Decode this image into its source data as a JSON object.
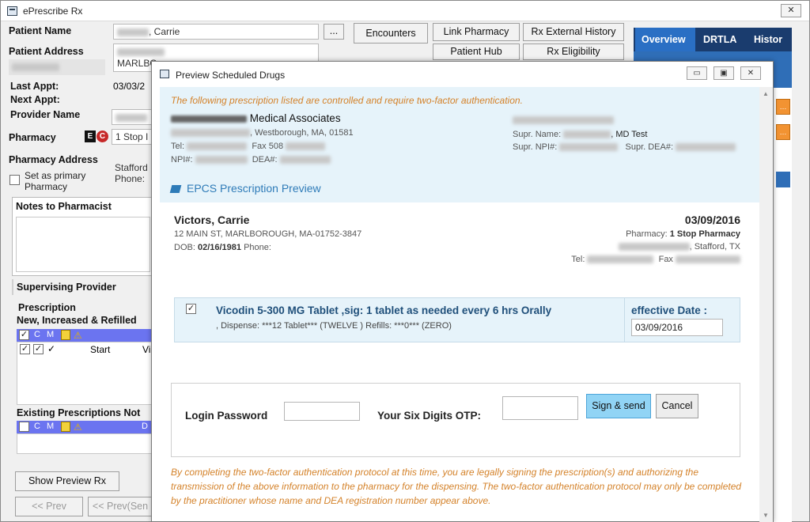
{
  "main": {
    "title": "ePrescribe Rx",
    "close_glyph": "✕",
    "labels": {
      "patient_name": "Patient Name",
      "patient_address": "Patient Address",
      "last_appt": "Last Appt:",
      "next_appt": "Next Appt:",
      "provider_name": "Provider Name",
      "pharmacy": "Pharmacy",
      "pharmacy_address": "Pharmacy Address",
      "set_primary": "Set as primary",
      "set_primary_2": "Pharmacy",
      "notes": "Notes to Pharmacist",
      "supervising": "Supervising Provider",
      "prescription": "Prescription",
      "new_increased": "New, Increased & Refilled",
      "existing": "Existing Prescriptions Not",
      "start_col": "Start",
      "vi_col": "Vi",
      "d_col": "D"
    },
    "values": {
      "patient_name_tail": ", Carrie",
      "address_line2": "MARLBO",
      "last_appt_value": "03/03/2",
      "pharmacy_value": "1 Stop I",
      "pharmacy_addr_1": "Stafford",
      "pharmacy_addr_2": "Phone:",
      "ellipsis": "..."
    },
    "buttons": {
      "encounters": "Encounters",
      "link_pharmacy": "Link Pharmacy",
      "rx_history": "Rx External History",
      "patient_hub": "Patient Hub",
      "rx_eligibility": "Rx Eligibility",
      "show_preview": "Show Preview Rx",
      "prev": "<< Prev",
      "prev_sen": "<< Prev(Sen"
    },
    "tabs": [
      "Overview",
      "DRTLA",
      "Histor"
    ],
    "grid_headers": [
      "C",
      "M"
    ]
  },
  "modal": {
    "title": "Preview Scheduled Drugs",
    "warning": "The following prescription listed are controlled and require two-factor authentication.",
    "practice_name": "Medical Associates",
    "practice_city": ", Westborough, MA, 01581",
    "tel_label": "Tel:",
    "fax_label": "Fax",
    "fax_prefix": "508",
    "npi_label": "NPI#:",
    "dea_label": "DEA#:",
    "supr_name_label": "Supr. Name:",
    "supr_name_tail": ", MD Test",
    "supr_npi_label": "Supr. NPI#:",
    "supr_dea_label": "Supr. DEA#:",
    "epcs_title": "EPCS Prescription Preview",
    "patient": {
      "name": "Victors, Carrie",
      "address": "12 MAIN ST, MARLBOROUGH, MA-01752-3847",
      "dob_label": "DOB:",
      "dob": "02/16/1981",
      "phone_label": "Phone:",
      "date": "03/09/2016",
      "pharmacy_label": "Pharmacy:",
      "pharmacy_name": "1 Stop Pharmacy",
      "pharmacy_city": ", Stafford, TX",
      "tel_label": "Tel:",
      "fax_label": "Fax"
    },
    "drug": {
      "checked": "✓",
      "name": "Vicodin 5-300 MG Tablet ,sig: 1 tablet as needed every 6 hrs Orally",
      "details": ", Dispense: ***12 Tablet*** (TWELVE ) Refills: ***0*** (ZERO)",
      "effective_label": "effective Date :",
      "effective_value": "03/09/2016"
    },
    "auth": {
      "login_label": "Login Password",
      "otp_label": "Your Six Digits OTP:",
      "sign_button": "Sign & send",
      "cancel_button": "Cancel"
    },
    "footer": "By completing the two-factor authentication protocol at this time, you are legally signing the prescription(s) and authorizing the transmission of the above information to the pharmacy for the dispensing. The two-factor authentication protocol may only be completed by the practitioner whose name and DEA registration number appear above.",
    "window_buttons": {
      "minimize": "▭",
      "restore": "▣",
      "close": "✕"
    }
  },
  "colors": {
    "warning": "#d4822a",
    "header_bg": "#e6f3fa",
    "drug_text": "#1f4f7a",
    "sign_button": "#91d4f5",
    "tab_bar": "#1a3c6e",
    "tab_active": "#2a6fc4"
  }
}
